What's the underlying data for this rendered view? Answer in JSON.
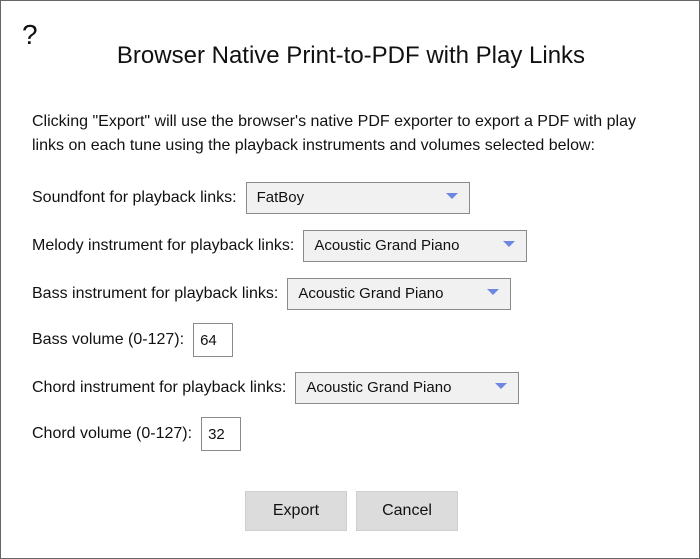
{
  "dialog": {
    "help_label": "?",
    "title": "Browser Native Print-to-PDF with Play Links",
    "description": "Clicking \"Export\" will use the browser's native PDF exporter to export a PDF with play links on each tune using the playback instruments and volumes selected below:"
  },
  "fields": {
    "soundfont": {
      "label": "Soundfont for playback links:",
      "value": "FatBoy"
    },
    "melody": {
      "label": "Melody instrument for playback links:",
      "value": "Acoustic Grand Piano"
    },
    "bass": {
      "label": "Bass instrument for playback links:",
      "value": "Acoustic Grand Piano"
    },
    "bass_volume": {
      "label": "Bass volume (0-127):",
      "value": "64"
    },
    "chord": {
      "label": "Chord instrument for playback links:",
      "value": "Acoustic Grand Piano"
    },
    "chord_volume": {
      "label": "Chord volume (0-127):",
      "value": "32"
    }
  },
  "buttons": {
    "export": "Export",
    "cancel": "Cancel"
  },
  "colors": {
    "select_arrow": "#6f86e0",
    "button_bg": "#dcdcdc"
  },
  "icons": {
    "dropdown": "triangle-down-icon"
  }
}
